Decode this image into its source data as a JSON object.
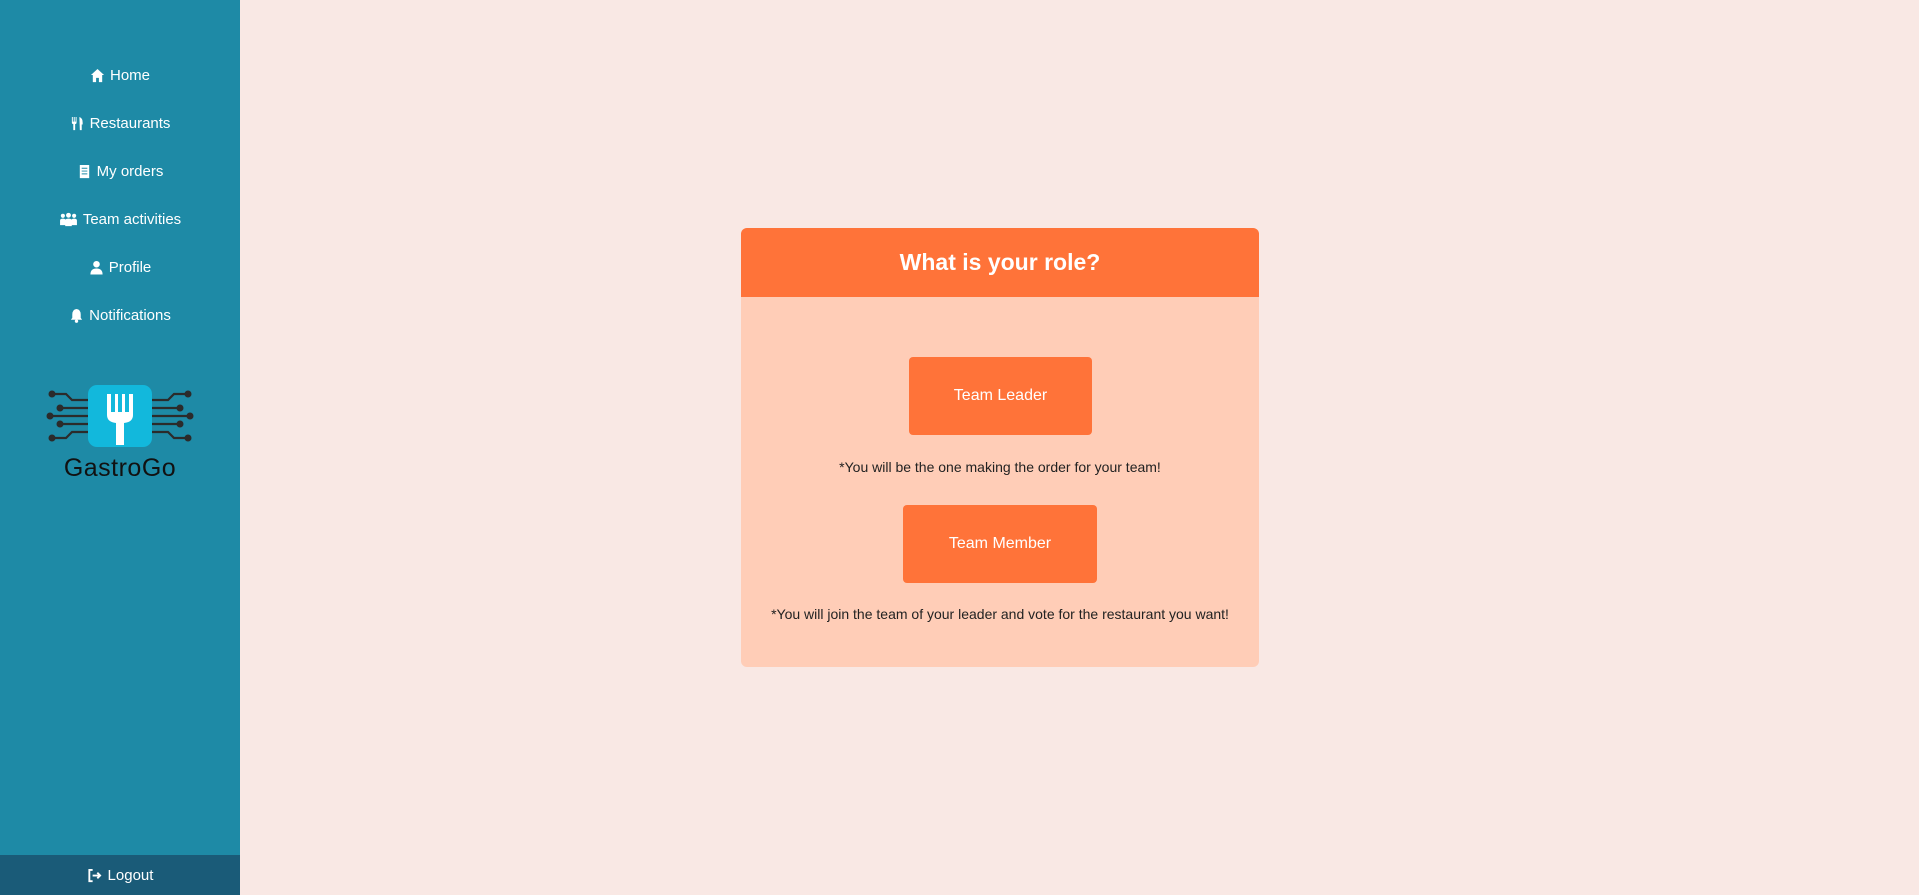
{
  "sidebar": {
    "items": [
      {
        "label": "Home",
        "icon": "home-icon"
      },
      {
        "label": "Restaurants",
        "icon": "utensils-icon"
      },
      {
        "label": "My orders",
        "icon": "receipt-icon"
      },
      {
        "label": "Team activities",
        "icon": "people-group-icon"
      },
      {
        "label": "Profile",
        "icon": "user-icon"
      },
      {
        "label": "Notifications",
        "icon": "bell-icon"
      }
    ],
    "logo_text": "GastroGo",
    "logout_label": "Logout",
    "background": "#1e8aa6",
    "logout_background": "#1a5b78"
  },
  "role_card": {
    "title": "What is your role?",
    "leader_button": "Team Leader",
    "leader_note": "*You will be the one making the order for your team!",
    "member_button": "Team Member",
    "member_note": "*You will join the team of your leader and vote for the restaurant you want!",
    "accent": "#ff7339",
    "card_background": "#ffcdb7"
  },
  "page_background": "#f9e8e4"
}
